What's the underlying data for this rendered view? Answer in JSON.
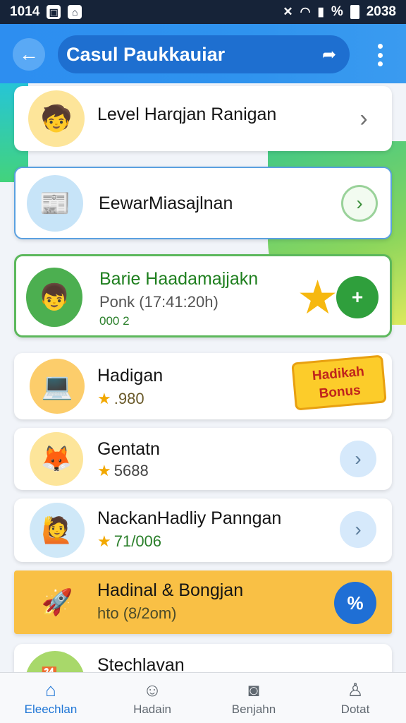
{
  "status_bar": {
    "time": "1014",
    "battery_text": "%",
    "right_time": "2038"
  },
  "header": {
    "title": "Casul Paukkauiar",
    "back_icon": "arrow-left-icon",
    "share_icon": "share-icon",
    "menu_icon": "more-vert-icon"
  },
  "list": {
    "items": [
      {
        "title": "Level Harqjan  Ranigan",
        "subtitle": ""
      },
      {
        "title": "EewarMiasajlnan",
        "subtitle": ""
      },
      {
        "title": "Barie Haadamajjakn",
        "subtitle": "Ponk (17:41:20h)",
        "count": "000 2"
      },
      {
        "title": "Hadigan",
        "subtitle": ".980",
        "badge": "Hadikah Bonus"
      },
      {
        "title": "Gentatn",
        "subtitle": "5688"
      },
      {
        "title": "NackanHadliy Panngan",
        "subtitle": "71/006"
      },
      {
        "title": "Hadinal & Bongjan",
        "subtitle": "hto (8/2om)",
        "action": "%"
      },
      {
        "title": "Stechlavan",
        "subtitle": ""
      }
    ]
  },
  "colors": {
    "accent": "#2d8ef0",
    "highlight_card": "#f9c045",
    "green_border": "#5cb85c"
  },
  "bottom_nav": {
    "items": [
      {
        "label": "Eleechlan",
        "icon": "home-icon",
        "active": true
      },
      {
        "label": "Hadain",
        "icon": "person-icon",
        "active": false
      },
      {
        "label": "Benjahn",
        "icon": "camera-icon",
        "active": false
      },
      {
        "label": "Dotat",
        "icon": "profile-icon",
        "active": false
      }
    ]
  }
}
